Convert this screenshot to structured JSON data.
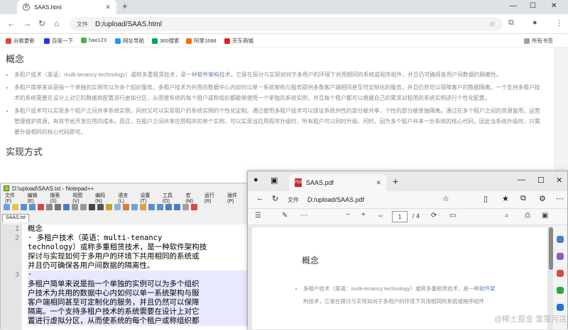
{
  "browser": {
    "tab_title": "SAAS.html",
    "address": "D:/upload/SAAS.html",
    "file_label": "文件",
    "bookmarks": [
      "谷歌更新",
      "百度一下",
      "hao123",
      "网址导航",
      "360搜索",
      "阿里1688",
      "京东商城"
    ],
    "all_bookmarks": "所有书签",
    "bookmark_colors": [
      "#ea4335",
      "#2932e1",
      "#4caf50",
      "#2196f3",
      "#00a65a",
      "#ff6a00",
      "#e1251b"
    ]
  },
  "page": {
    "heading1": "概念",
    "bullets": [
      {
        "pre": "多租户技术（英语：multi-tenancy technology）或称多重租赁技术，是一种",
        "link": "软件架构",
        "post": "技术，它是在探讨与实现如何于多用户的环境下共用相同的系统或程序组件，并且仍可确保各用户间数据的隔离性。"
      },
      {
        "pre": "多租户简单来说是指一个单独的实例可以为多个组织服务。多租户技术为共用的数据中心内如何以单一系统架构与服务提供多数客户端相同甚至可定制化的服务，并且仍然可以保障客户的数据隔离。一个支持多租户技术的系统需要在设计上对它的数据和配置进行虚拟分区，从而使系统的每个租户或称组织都能够使用一个单独的系统实例，并且每个租户都可以根据自己的需求对租用的系统实例进行个性化配置。",
        "link": "",
        "post": ""
      },
      {
        "pre": "多租户技术可以实现多个租户之间共享系统实例，同时又可以实现租户的系统实例的个性化定制。通过使用多租户技术可以保证系统共性的部分被共享，个性的部分被单独隔离。通过在多个租户之间的资源复用，运营管理维护资源，有效节省开发应用的成本。而且，在租户之间共享应用程序的单个实例，可以实现当应用程序升级时，所有租户可以同时升级。同时，因为多个租户共享一份系统的核心代码，因此当系统升级时，只需要升级相同的核心代码即可。",
        "link": "",
        "post": ""
      }
    ],
    "heading2": "实现方式"
  },
  "notepad": {
    "title": "D:\\upload\\SAAS.txt - Notepad++",
    "menu": [
      "文件(F)",
      "编辑(E)",
      "搜索(S)",
      "视图(V)",
      "编码(N)",
      "语言(L)",
      "设置(T)",
      "工具(O)",
      "宏(M)",
      "运行(R)",
      "插件(P)"
    ],
    "file_tab": "SAAS.txt",
    "line_numbers": [
      "1",
      "2",
      "",
      "",
      "",
      "3",
      "",
      "",
      "",
      "",
      ""
    ],
    "lines": [
      "概念",
      "· 多租户技术（英语：multi-tenancy",
      "technology）或称多重租赁技术，是一种软件架构技",
      "探讨与实现如何于多用户的环境下共用相同的系统或",
      "并且仍可确保各用户间数据的隔离性。",
      "·",
      "多租户简单来说是指一个单独的实例可以为多个组织",
      "户技术为共用的数据中心内如何以单一系统架构与服",
      "客户端相同甚至可定制化的服务，并且仍然可以保障",
      "隔离。一个支持多租户技术的系统需要在设计上对它",
      "置进行虚拟分区，从而使系统的每个租户或称组织都"
    ]
  },
  "pdf": {
    "tab_title": "SAAS.pdf",
    "file_label": "文件",
    "address": "D:/upload/SAAS.pdf",
    "page_current": "1",
    "page_total": "/ 4",
    "heading": "概念",
    "bullet_pre": "多租户技术（英语：multi-tenancy technology）或称多重租赁技术，是一种",
    "bullet_link": "软件架",
    "bullet_line2": "构技术，它是在探讨与实现如何于多用户的环境下共用相同的系统或程序组件"
  },
  "watermark": "@稀土掘金 雷雯月店"
}
